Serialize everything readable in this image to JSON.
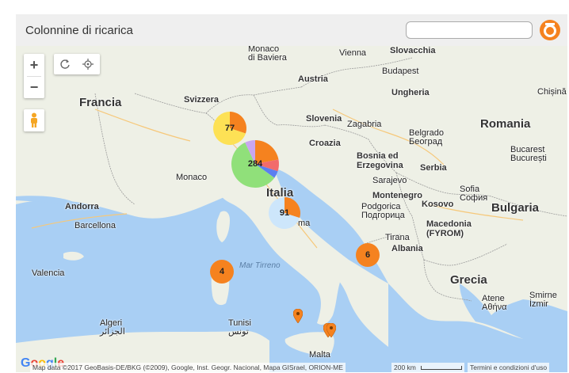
{
  "app": {
    "title": "Colonnine di ricarica",
    "search_value": ""
  },
  "controls": {
    "zoom_in": "+",
    "zoom_out": "−",
    "refresh_icon": "refresh-icon",
    "locate_icon": "locate-icon",
    "pegman_icon": "pegman-icon"
  },
  "map_labels": {
    "countries": {
      "francia": "Francia",
      "svizzera": "Svizzera",
      "austria": "Austria",
      "italia": "Italia",
      "romania": "Romania",
      "slovenia": "Slovenia",
      "croazia": "Croazia",
      "bosnia": "Bosnia ed\nErzegovina",
      "serbia": "Serbia",
      "montenegro": "Montenegro",
      "kosovo": "Kosovo",
      "bulgaria": "Bulgaria",
      "macedonia": "Macedonia\n(FYROM)",
      "albania": "Albania",
      "grecia": "Grecia",
      "ungheria": "Ungheria",
      "slovacchia": "Slovacchia",
      "andorra": "Andorra"
    },
    "cities": {
      "munich": "Monaco\ndi Baviera",
      "vienna": "Vienna",
      "budapest": "Budapest",
      "zagabria": "Zagabria",
      "belgrado": "Belgrado\nБеоград",
      "bucarest": "Bucarest\nBucurești",
      "sarajevo": "Sarajevo",
      "podgorica": "Podgorica\nПодгорица",
      "sofia": "Sofia\nСофия",
      "tirana": "Tirana",
      "barcellona": "Barcellona",
      "valencia": "Valencia",
      "algeri": "Algeri\nالجزائر",
      "tunisi": "Tunisi\nتونس",
      "atene": "Atene\nΑθήνα",
      "smirne": "Smirne\nİzmir",
      "malta": "Malta",
      "monaco": "Monaco",
      "chisina": "Chișină",
      "roma_partial": "ma"
    },
    "seas": {
      "tirreno": "Mar Tirreno"
    }
  },
  "clusters": [
    {
      "count": "77",
      "slices": [
        {
          "value": 0.3,
          "color": "#f5821f"
        },
        {
          "value": 0.7,
          "color": "#fde155"
        }
      ]
    },
    {
      "count": "284",
      "slices": [
        {
          "value": 0.22,
          "color": "#f5821f"
        },
        {
          "value": 0.08,
          "color": "#f26b6b"
        },
        {
          "value": 0.05,
          "color": "#5b7ef0"
        },
        {
          "value": 0.58,
          "color": "#90e07a"
        },
        {
          "value": 0.07,
          "color": "#c9a6ef"
        }
      ]
    },
    {
      "count": "91",
      "slices": [
        {
          "value": 0.3,
          "color": "#f5821f"
        },
        {
          "value": 0.7,
          "color": "#cde6fb"
        }
      ]
    },
    {
      "count": "6",
      "slices": [
        {
          "value": 1.0,
          "color": "#f5821f"
        }
      ]
    },
    {
      "count": "4",
      "slices": [
        {
          "value": 1.0,
          "color": "#f5821f"
        }
      ]
    }
  ],
  "footer": {
    "attribution": "Map data ©2017 GeoBasis-DE/BKG (©2009), Google, Inst. Geogr. Nacional, Mapa GISrael, ORION-ME",
    "scale": "200 km",
    "terms": "Termini e condizioni d'uso",
    "google_logo": "Google"
  },
  "colors": {
    "land": "#eef0e6",
    "sea": "#a9cff4",
    "border": "#9a9a9a",
    "brand": "#f5821f"
  }
}
